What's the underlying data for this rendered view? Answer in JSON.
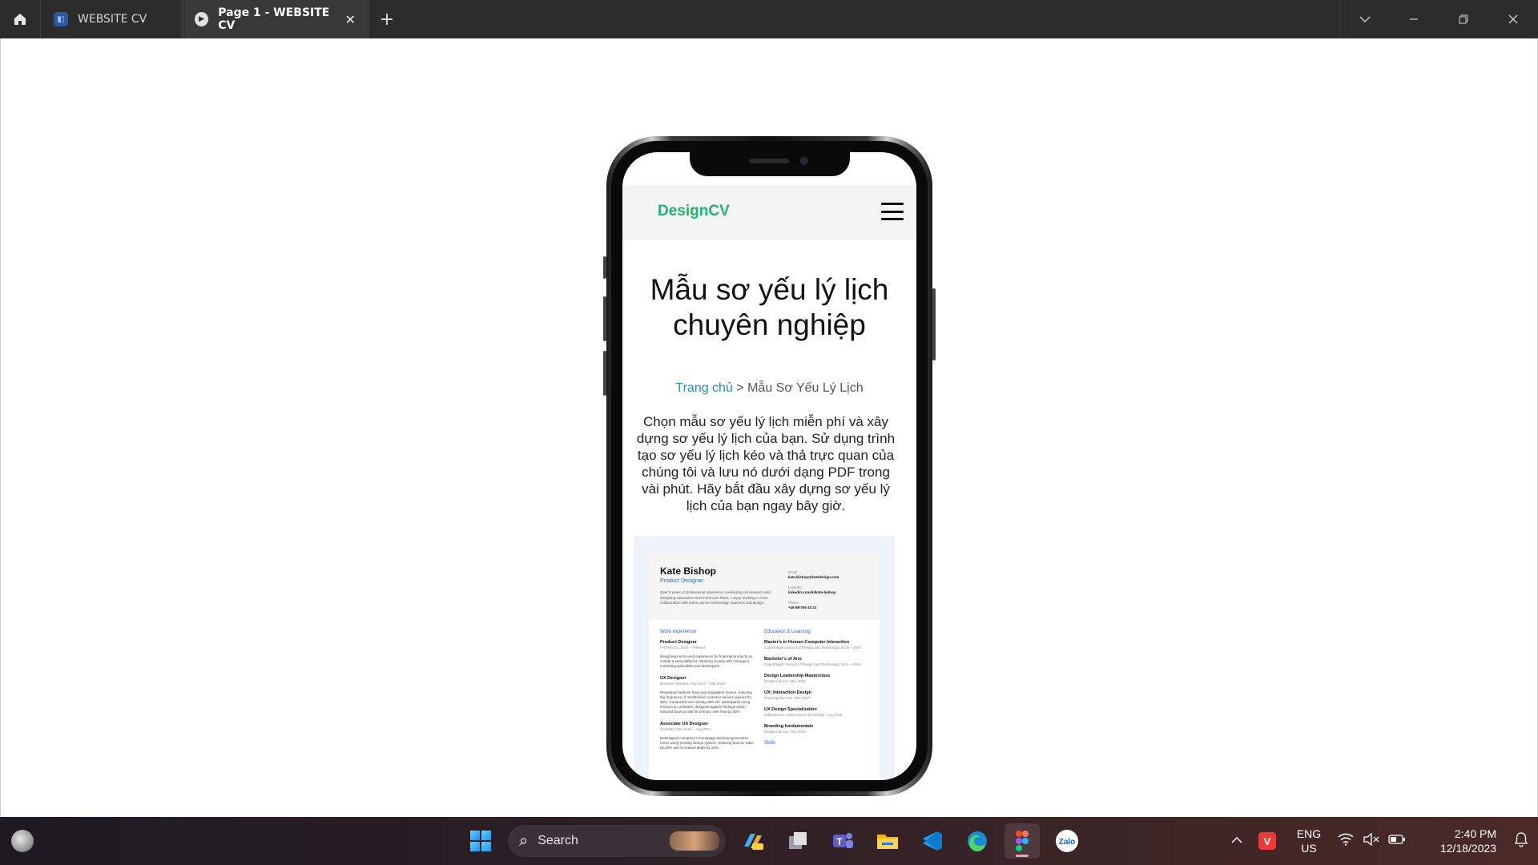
{
  "titlebar": {
    "home_icon": "home-icon",
    "tabs": [
      {
        "label": "WEBSITE CV",
        "icon": "figma-file-icon",
        "active": false
      },
      {
        "label": "Page 1 - WEBSITE CV",
        "icon": "prototype-play-icon",
        "active": true,
        "close": "✕"
      }
    ],
    "add_tab": "+",
    "controls": {
      "dropdown": "⌄",
      "minimize": "—",
      "restore": "❐",
      "close": "✕"
    }
  },
  "phone": {
    "brand": "DesignCV",
    "menu_icon": "hamburger-menu-icon",
    "hero_title": "Mẫu sơ yếu lý lịch chuyên nghiệp",
    "breadcrumb": {
      "home": "Trang chủ",
      "separator": " > ",
      "current": "Mẫu Sơ Yếu Lý Lịch"
    },
    "intro": "Chọn mẫu sơ yếu lý lịch miễn phí và xây dựng sơ yếu lý lịch của bạn. Sử dụng trình tạo sơ yếu lý lịch kéo và thả trực quan của chúng tôi và lưu nó dưới dạng PDF trong vài phút. Hãy bắt đầu xây dựng sơ yếu lý lịch của bạn ngay bây giờ.",
    "cv": {
      "name": "Kate Bishop",
      "role": "Product Designer",
      "summary": "Over 5 years of professional experience conducting UX research and designing interactive end-to-end user flows. I enjoy working in close collaboration with teams across technology, business and design.",
      "contact": [
        {
          "label": "Email",
          "value": "kate.bishop@katedesign.com"
        },
        {
          "label": "LinkedIn",
          "value": "linkedin.com/in/kate-bishop"
        },
        {
          "label": "Phone",
          "value": "+46 98-765 43 21"
        }
      ],
      "work_heading": "Work experience",
      "work": [
        {
          "title": "Product Designer",
          "sub": "FinTech Inc. 2019 – Present",
          "desc": "Designing end-to-end experience for financial products on mobile & web platforms. Working closely with managers, marketing specialists and developers."
        },
        {
          "title": "UX Designer",
          "sub": "Business Wanted, Sep 2017 – Sep 2019",
          "desc": "Revamped website flows and navigation menus, reducing the frequency of misdirected customer service queries by 35%. Conducted user testing with 40+ participants using InVision & Lookback, designed against findings which reduced bounce rate for primary user flow by 30%."
        },
        {
          "title": "Associate UX Designer",
          "sub": "Consulto, Dec 2016 – Aug 2017",
          "desc": "Redesigned company's homepage and lead generation forms using existing design system, reducing bounce rates by 40% and increased leads by 15%."
        }
      ],
      "edu_heading": "Education & Learning",
      "education": [
        {
          "title": "Master's in Human-Computer Interaction",
          "sub": "Copenhagen School of Design and Technology, 2015 – 2016"
        },
        {
          "title": "Bachelor's of Arts",
          "sub": "Copenhagen School of Design and Technology, 2011 – 2015"
        },
        {
          "title": "Design Leadership Masterclass",
          "sub": "Design Lab Inc, Mar 2020"
        },
        {
          "title": "UX: Interaction Design",
          "sub": "Trydesignlab.com, Dec 2017"
        },
        {
          "title": "UX Design Specialization",
          "sub": "Udacity.com, online course by Google, Aug 2016"
        },
        {
          "title": "Branding fundamentals",
          "sub": "Design Lab Inc, Nov 2016"
        }
      ],
      "skills_heading": "Skills"
    }
  },
  "taskbar": {
    "weather_icon": "weather-cloud-icon",
    "search_placeholder": "Search",
    "apps": [
      "start-icon",
      "copilot-icon",
      "task-view-icon",
      "teams-icon",
      "file-explorer-icon",
      "vscode-icon",
      "edge-icon",
      "figma-icon",
      "zalo-icon"
    ],
    "active_app": "figma-icon",
    "zalo_label": "Zalo",
    "vivaldi_label": "V",
    "lang_top": "ENG",
    "lang_bottom": "US",
    "time": "2:40 PM",
    "date": "12/18/2023",
    "colors": {
      "brand_green": "#21b573",
      "link_blue": "#2d8bc0",
      "cv_accent": "#2563eb"
    }
  }
}
